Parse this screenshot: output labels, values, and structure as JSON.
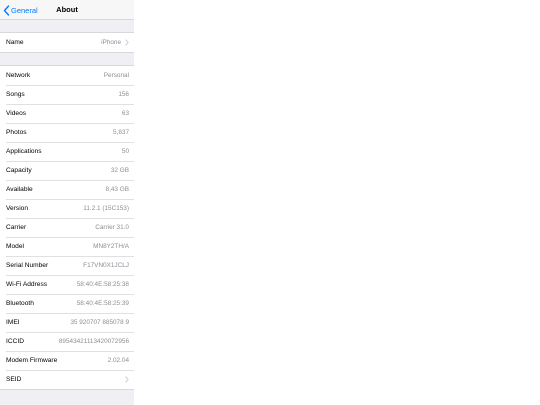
{
  "navbar": {
    "back_label": "General",
    "title": "About"
  },
  "name_row": {
    "label": "Name",
    "value": "iPhone"
  },
  "info_rows": [
    {
      "label": "Network",
      "value": "Personal"
    },
    {
      "label": "Songs",
      "value": "156"
    },
    {
      "label": "Videos",
      "value": "63"
    },
    {
      "label": "Photos",
      "value": "5,837"
    },
    {
      "label": "Applications",
      "value": "50"
    },
    {
      "label": "Capacity",
      "value": "32 GB"
    },
    {
      "label": "Available",
      "value": "8,43 GB"
    },
    {
      "label": "Version",
      "value": "11.2.1 (15C153)"
    },
    {
      "label": "Carrier",
      "value": "Carrier 31.0"
    },
    {
      "label": "Model",
      "value": "MN8Y2TH/A"
    },
    {
      "label": "Serial Number",
      "value": "F17VN0X1JCLJ"
    },
    {
      "label": "Wi-Fi Address",
      "value": "58:40:4E:58:25:38"
    },
    {
      "label": "Bluetooth",
      "value": "58:40:4E:58:25:39"
    },
    {
      "label": "IMEI",
      "value": "35 920707 885078 9"
    },
    {
      "label": "ICCID",
      "value": "89543421113420072956"
    },
    {
      "label": "Modem Firmware",
      "value": "2.02.04"
    },
    {
      "label": "SEID",
      "value": ""
    }
  ],
  "colors": {
    "accent": "#007aff",
    "group_background": "#efeff4",
    "value_text": "#8e8e93"
  },
  "icons": {
    "back": "chevron-left-icon",
    "disclosure": "chevron-right-icon"
  }
}
